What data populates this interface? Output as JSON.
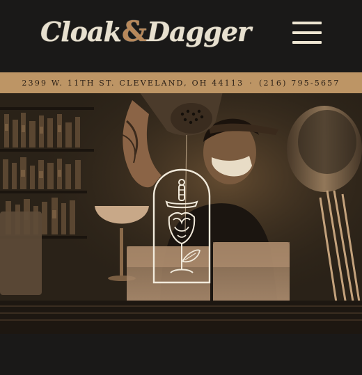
{
  "brand": {
    "word1": "Cloak",
    "amp": "&",
    "word2": "Dagger"
  },
  "nav": {
    "menu_icon": "hamburger-menu-icon"
  },
  "address_bar": {
    "address": "2399 W. 11TH ST. CLEVELAND, OH 44113",
    "separator": "·",
    "phone": "(216) 795-5657"
  },
  "hero": {
    "emblem_icon": "rose-dagger-arch-emblem-icon"
  },
  "colors": {
    "background": "#1a1918",
    "accent_gold": "#bd9565",
    "logo_cream": "#e7e0cf",
    "amp_copper": "#b8885a",
    "emblem_line": "#f1eadb"
  }
}
